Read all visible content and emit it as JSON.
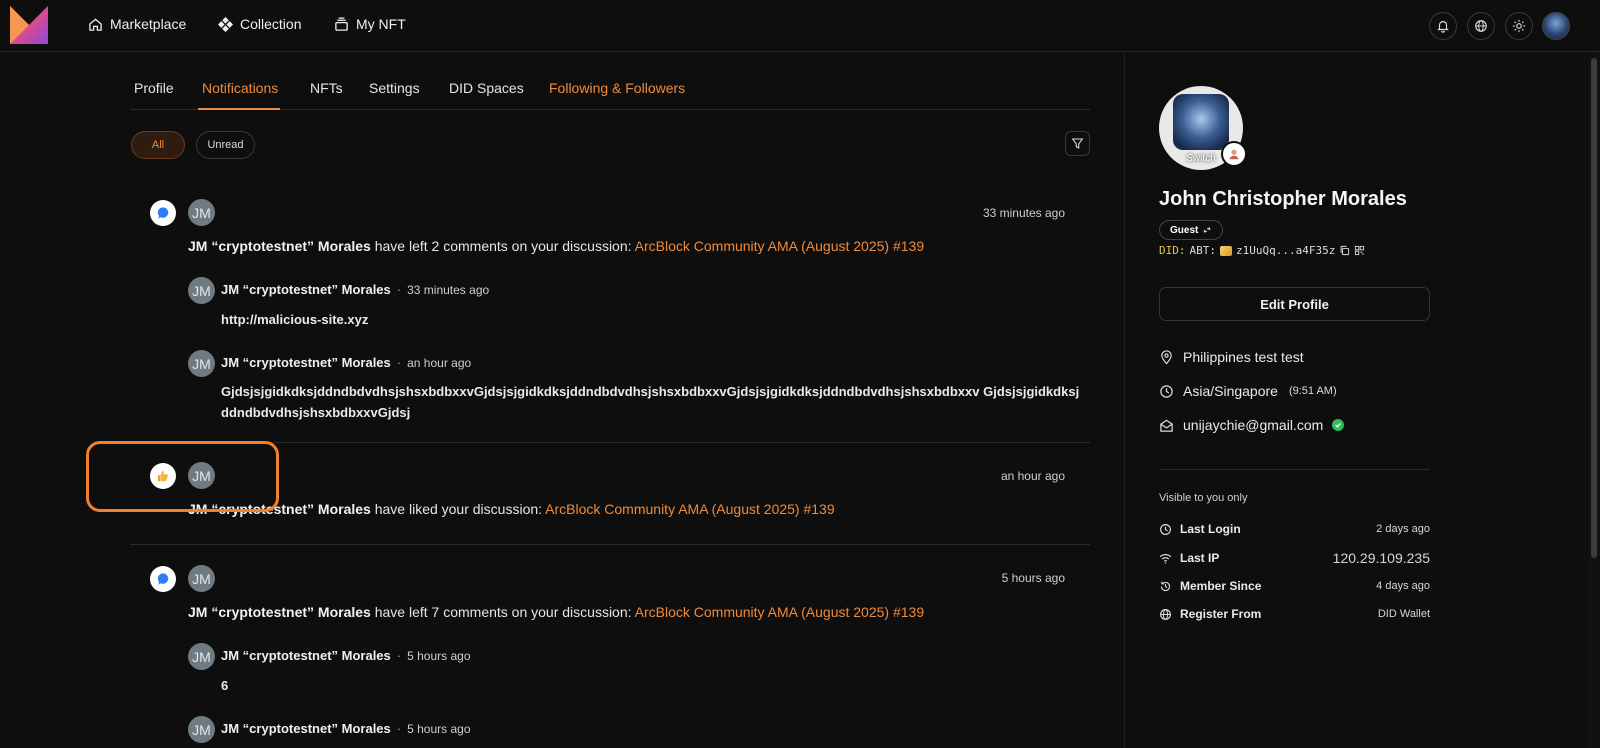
{
  "nav": {
    "items": [
      {
        "label": "Marketplace",
        "icon": "home-icon"
      },
      {
        "label": "Collection",
        "icon": "collection-icon"
      },
      {
        "label": "My NFT",
        "icon": "stack-icon"
      }
    ]
  },
  "tabs": [
    {
      "label": "Profile"
    },
    {
      "label": "Notifications",
      "active": true
    },
    {
      "label": "NFTs"
    },
    {
      "label": "Settings"
    },
    {
      "label": "DID Spaces"
    },
    {
      "label": "Following & Followers",
      "accent": true
    }
  ],
  "filters": {
    "all": "All",
    "unread": "Unread"
  },
  "notifications": [
    {
      "type": "comment",
      "avatar": "JM",
      "time": "33 minutes ago",
      "actor": "JM “cryptotestnet” Morales",
      "action": "have left 2 comments on your discussion:",
      "link": "ArcBlock Community AMA (August 2025) #139",
      "comments": [
        {
          "author": "JM “cryptotestnet” Morales",
          "time": "33 minutes ago",
          "body": "http://malicious-site.xyz"
        },
        {
          "author": "JM “cryptotestnet” Morales",
          "time": "an hour ago",
          "body": "GjdsjsjgidkdksjddndbdvdhsjshsxbdbxxvGjdsjsjgidkdksjddndbdvdhsjshsxbdbxxvGjdsjsjgidkdksjddndbdvdhsjshsxbdbxxv GjdsjsjgidkdksjddndbdvdhsjshsxbdbxxvGjdsj"
        }
      ]
    },
    {
      "type": "like",
      "avatar": "JM",
      "time": "an hour ago",
      "actor": "JM “cryptotestnet” Morales",
      "action": "have liked your discussion:",
      "link": "ArcBlock Community AMA (August 2025) #139"
    },
    {
      "type": "comment",
      "avatar": "JM",
      "time": "5 hours ago",
      "actor": "JM “cryptotestnet” Morales",
      "action": "have left 7 comments on your discussion:",
      "link": "ArcBlock Community AMA (August 2025) #139",
      "comments": [
        {
          "author": "JM “cryptotestnet” Morales",
          "time": "5 hours ago",
          "body": "6"
        },
        {
          "author": "JM “cryptotestnet” Morales",
          "time": "5 hours ago",
          "body": ""
        }
      ]
    }
  ],
  "profile": {
    "switch_label": "Switch",
    "name": "John Christopher Morales",
    "role": "Guest",
    "did_prefix": "DID:",
    "did_chain": "ABT:",
    "did_short": "z1UuQq...a4F35z",
    "edit_label": "Edit Profile",
    "location": "Philippines test test",
    "timezone": "Asia/Singapore",
    "local_time": "(9:51 AM)",
    "email": "unijaychie@gmail.com",
    "visible_label": "Visible to you only",
    "stats": [
      {
        "label": "Last Login",
        "value": "2 days ago",
        "icon": "clock-icon"
      },
      {
        "label": "Last IP",
        "value": "120.29.109.235",
        "icon": "wifi-icon"
      },
      {
        "label": "Member Since",
        "value": "4 days ago",
        "icon": "history-icon"
      },
      {
        "label": "Register From",
        "value": "DID Wallet",
        "icon": "globe-icon"
      }
    ]
  },
  "colors": {
    "accent": "#f08a3a",
    "background": "#0e0e0e",
    "highlight": "#f07f2e",
    "verified": "#2fbf5a"
  }
}
